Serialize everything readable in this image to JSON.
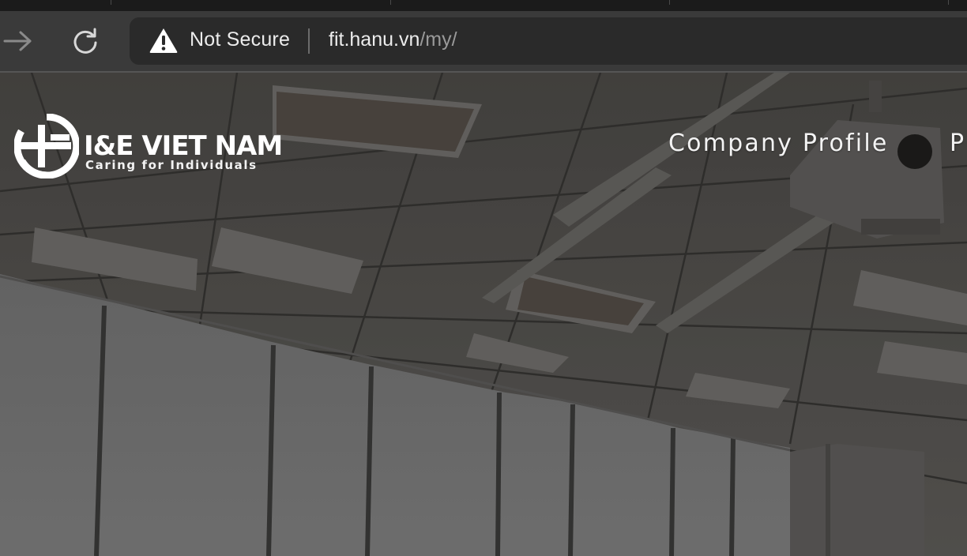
{
  "browser": {
    "security_label": "Not Secure",
    "url_host": "fit.hanu.vn",
    "url_path": "/my/",
    "icons": {
      "forward": "arrow-right-icon",
      "reload": "reload-icon",
      "security": "warning-triangle-icon"
    }
  },
  "site": {
    "logo_name": "I&E VIET NAM",
    "logo_tagline": "Caring for Individuals",
    "nav": [
      {
        "label": "Company Profile"
      },
      {
        "label": "P"
      }
    ]
  },
  "colors": {
    "toolbar": "#3a3a3a",
    "omnibox": "#2a2a2a",
    "url_path": "#9a9a9a",
    "hero_overlay": "#3c3a38"
  }
}
